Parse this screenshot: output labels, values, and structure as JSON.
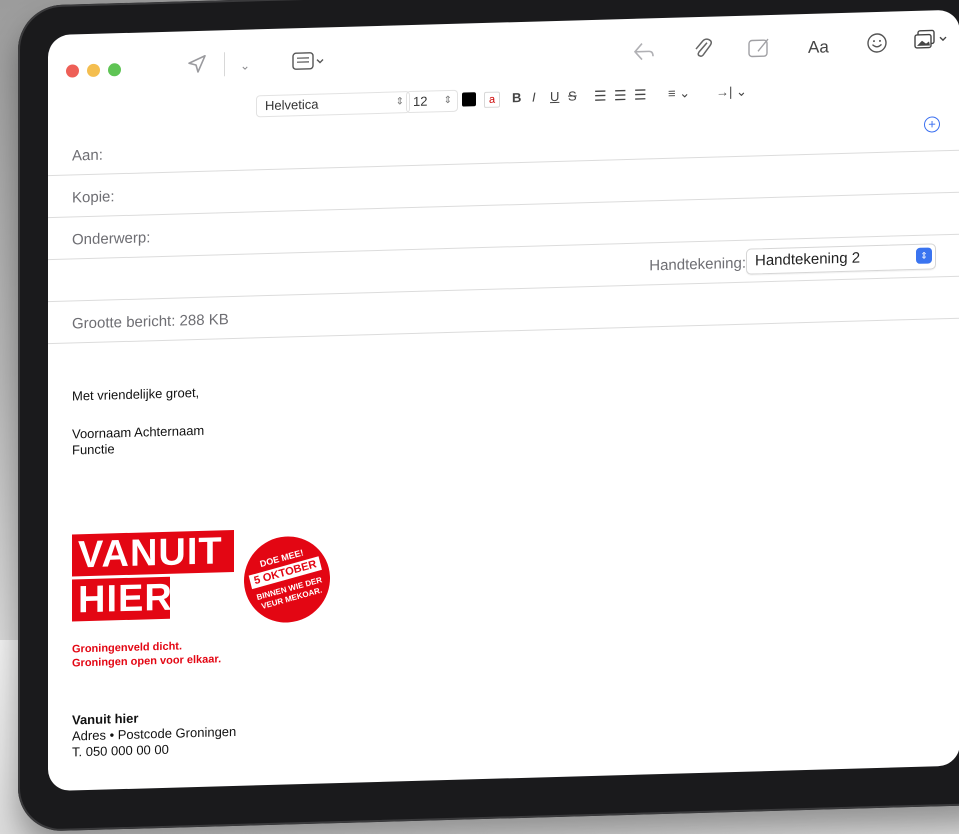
{
  "toolbar": {
    "icons": [
      "close-dot",
      "minimize-dot",
      "zoom-dot",
      "send-icon",
      "chevron-down-icon",
      "header-fields-icon",
      "reply-icon",
      "attachment-icon",
      "markup-icon",
      "format-icon",
      "emoji-icon",
      "photo-browser-icon"
    ],
    "format_label": "Aa"
  },
  "format_bar": {
    "font": "Helvetica",
    "size": "12",
    "bold": "B",
    "italic": "I",
    "underline": "U",
    "strike": "S"
  },
  "header": {
    "to_label": "Aan:",
    "cc_label": "Kopie:",
    "subject_label": "Onderwerp:",
    "signature_label": "Handtekening:",
    "signature_value": "Handtekening 2",
    "message_size": "Grootte bericht: 288 KB"
  },
  "message": {
    "greeting": "Met vriendelijke groet,",
    "name": "Voornaam Achternaam",
    "role": "Functie"
  },
  "logo": {
    "line1": "VANUIT",
    "line2": "HIER",
    "badge_top": "DOE MEE!",
    "badge_date": "5 OKTOBER",
    "badge_line1": "BINNEN WIE DER",
    "badge_line2": "VEUR MEKOAR.",
    "tagline1": "Groningenveld dicht.",
    "tagline2": "Groningen open voor elkaar."
  },
  "footer": {
    "org": "Vanuit hier",
    "address": "Adres  •  Postcode Groningen",
    "phone": "T. 050 000 00 00"
  },
  "colors": {
    "close": "#ee5f57",
    "minimize": "#f4be4f",
    "zoom": "#5fc454",
    "brand_red": "#e30613",
    "accent_blue": "#3a74f0"
  }
}
